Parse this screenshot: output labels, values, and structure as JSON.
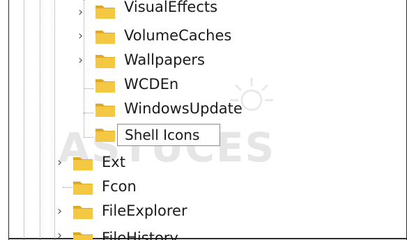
{
  "tree": {
    "items": [
      {
        "label": "VisualEffects",
        "expandable": true
      },
      {
        "label": "VolumeCaches",
        "expandable": true
      },
      {
        "label": "Wallpapers",
        "expandable": true
      },
      {
        "label": "WCDEn",
        "expandable": false
      },
      {
        "label": "WindowsUpdate",
        "expandable": false
      },
      {
        "label": "Shell Icons",
        "expandable": false,
        "editing": true
      },
      {
        "label": "Ext",
        "expandable": true
      },
      {
        "label": "Fcon",
        "expandable": false
      },
      {
        "label": "FileExplorer",
        "expandable": true
      },
      {
        "label": "FileHistory",
        "expandable": true
      }
    ]
  },
  "watermark": {
    "text": "ASTUCES"
  },
  "colors": {
    "folder": "#f4c842",
    "folder_dark": "#e0a82a",
    "guide": "#9a9a9a"
  },
  "icons": {
    "folder": "folder-icon",
    "chevron": "chevron-right-icon"
  }
}
